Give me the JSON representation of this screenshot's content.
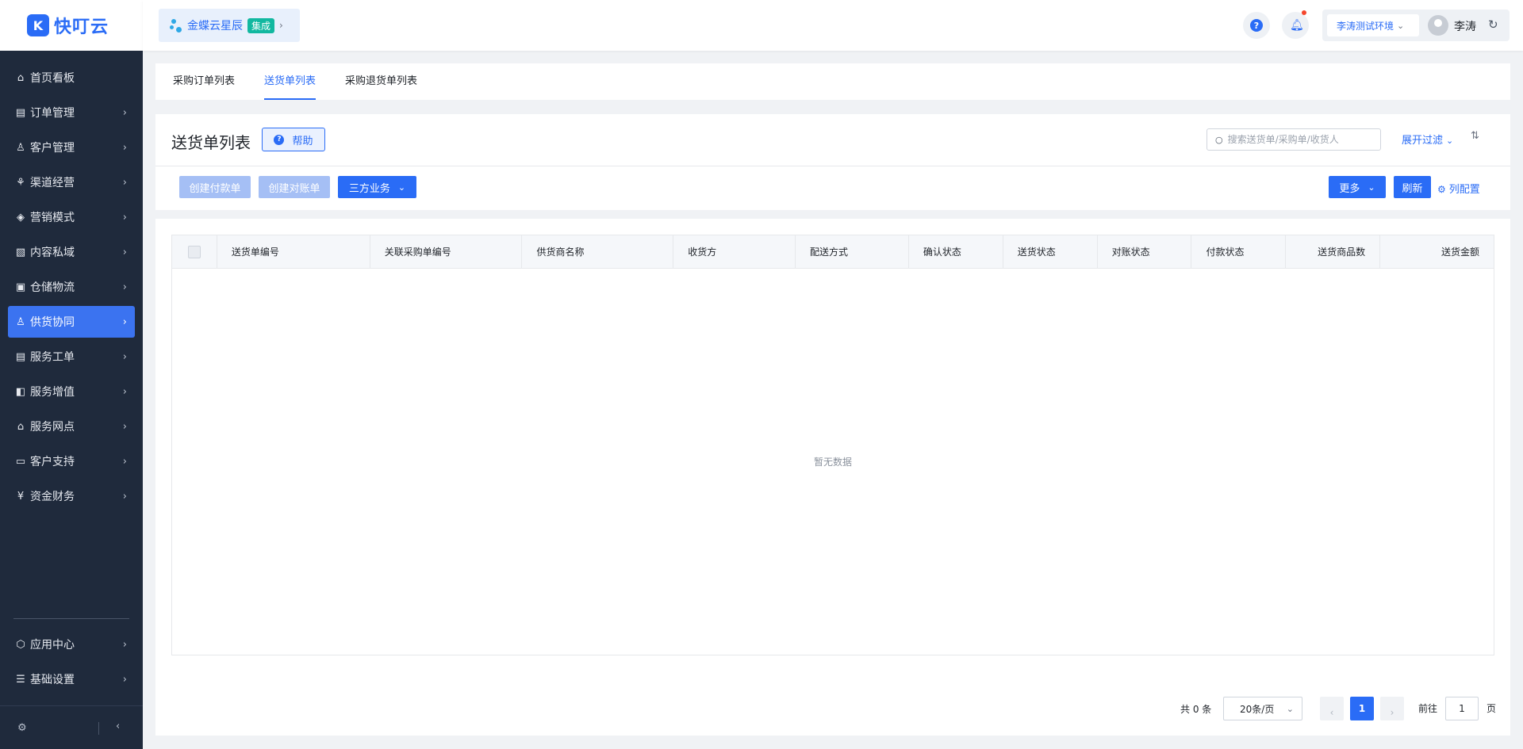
{
  "app": {
    "logo_mark": "K",
    "logo_text": "快叮云"
  },
  "header": {
    "brand_name": "金蝶云星辰",
    "brand_badge": "集成",
    "help_icon": "?",
    "env_label": "李涛测试环境",
    "user_name": "李涛"
  },
  "sidebar": {
    "items": [
      {
        "label": "首页看板",
        "icon": "home-icon",
        "glyph": "⌂",
        "has_chevron": false
      },
      {
        "label": "订单管理",
        "icon": "clipboard-icon",
        "glyph": "▤",
        "has_chevron": true
      },
      {
        "label": "客户管理",
        "icon": "user-icon",
        "glyph": "♙",
        "has_chevron": true
      },
      {
        "label": "渠道经营",
        "icon": "network-icon",
        "glyph": "⚘",
        "has_chevron": true
      },
      {
        "label": "营销模式",
        "icon": "tag-icon",
        "glyph": "◈",
        "has_chevron": true
      },
      {
        "label": "内容私域",
        "icon": "image-icon",
        "glyph": "▧",
        "has_chevron": true
      },
      {
        "label": "仓储物流",
        "icon": "box-icon",
        "glyph": "▣",
        "has_chevron": true
      },
      {
        "label": "供货协同",
        "icon": "supplier-icon",
        "glyph": "♙",
        "has_chevron": true,
        "active": true
      },
      {
        "label": "服务工单",
        "icon": "ticket-icon",
        "glyph": "▤",
        "has_chevron": true
      },
      {
        "label": "服务增值",
        "icon": "bag-icon",
        "glyph": "◧",
        "has_chevron": true
      },
      {
        "label": "服务网点",
        "icon": "store-icon",
        "glyph": "⌂",
        "has_chevron": true
      },
      {
        "label": "客户支持",
        "icon": "support-icon",
        "glyph": "▭",
        "has_chevron": true
      },
      {
        "label": "资金财务",
        "icon": "yuan-icon",
        "glyph": "¥",
        "has_chevron": true
      }
    ],
    "bottom_items": [
      {
        "label": "应用中心",
        "icon": "cube-icon",
        "glyph": "⬡",
        "has_chevron": true
      },
      {
        "label": "基础设置",
        "icon": "settings-list-icon",
        "glyph": "☰",
        "has_chevron": true
      }
    ]
  },
  "tabs": [
    {
      "label": "采购订单列表",
      "active": false
    },
    {
      "label": "送货单列表",
      "active": true
    },
    {
      "label": "采购退货单列表",
      "active": false
    }
  ],
  "page": {
    "title": "送货单列表",
    "help_label": "帮助",
    "search_placeholder": "搜索送货单/采购单/收货人",
    "expand_filter": "展开过滤",
    "buttons": {
      "create_payment": "创建付款单",
      "create_reconcile": "创建对账单",
      "third_party": "三方业务",
      "more": "更多",
      "refresh": "刷新",
      "column_config": "列配置"
    }
  },
  "table": {
    "columns": [
      {
        "label": "送货单编号"
      },
      {
        "label": "关联采购单编号"
      },
      {
        "label": "供货商名称"
      },
      {
        "label": "收货方"
      },
      {
        "label": "配送方式"
      },
      {
        "label": "确认状态"
      },
      {
        "label": "送货状态"
      },
      {
        "label": "对账状态"
      },
      {
        "label": "付款状态"
      },
      {
        "label": "送货商品数",
        "align": "right"
      },
      {
        "label": "送货金额",
        "align": "right"
      }
    ],
    "empty_text": "暂无数据"
  },
  "pagination": {
    "total_text": "共 0 条",
    "page_size": "20条/页",
    "current_page": "1",
    "goto_label": "前往",
    "goto_value": "1",
    "page_unit": "页"
  },
  "colors": {
    "primary": "#2a6cf6",
    "sidebar_bg": "#1f2a3c",
    "sidebar_active": "#3b73f0",
    "badge_green": "#12b8a0",
    "notify_red": "#f5462c"
  }
}
